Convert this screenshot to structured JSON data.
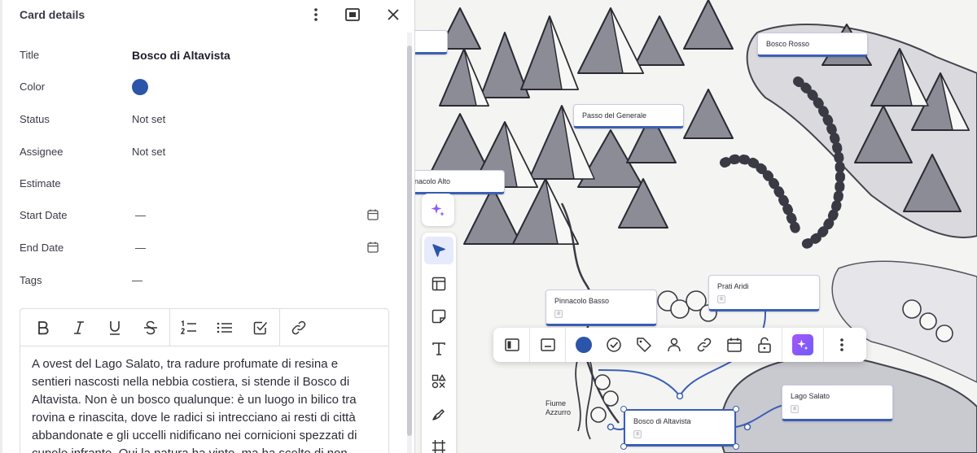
{
  "panel": {
    "title": "Card details",
    "fields": {
      "title_label": "Title",
      "title_value": "Bosco di Altavista",
      "color_label": "Color",
      "status_label": "Status",
      "status_value": "Not set",
      "assignee_label": "Assignee",
      "assignee_value": "Not set",
      "estimate_label": "Estimate",
      "start_label": "Start Date",
      "start_value": "—",
      "end_label": "End Date",
      "end_value": "—",
      "tags_label": "Tags",
      "tags_value": "—"
    },
    "description": "A ovest del Lago Salato, tra radure profumate di resina e sentieri nascosti nella nebbia costiera, si stende il Bosco di Altavista. Non è un bosco qualunque: è un luogo in bilico tra rovina e rinascita, dove le radici si intrecciano ai resti di città abbandonate e gli uccelli nidificano nei cornicioni spezzati di cupole infrante. Qui la natura ha vinto, ma ha scelto di non"
  },
  "canvas": {
    "cards": {
      "bosco_rosso": "Bosco Rosso",
      "passo": "Passo del Generale",
      "pinnacolo_alto": "nacolo Alto",
      "pinnacolo_basso": "Pinnacolo Basso",
      "prati_aridi": "Prati Aridi",
      "lago_salato": "Lago Salato",
      "bosco_altavista": "Bosco di Altavista"
    },
    "labels": {
      "fiume_line1": "Fiume",
      "fiume_line2": "Azzurro"
    }
  },
  "colors": {
    "accent": "#3b5fb5",
    "card_color": "#2b55a8",
    "ai_purple": "#8b5cf6"
  }
}
